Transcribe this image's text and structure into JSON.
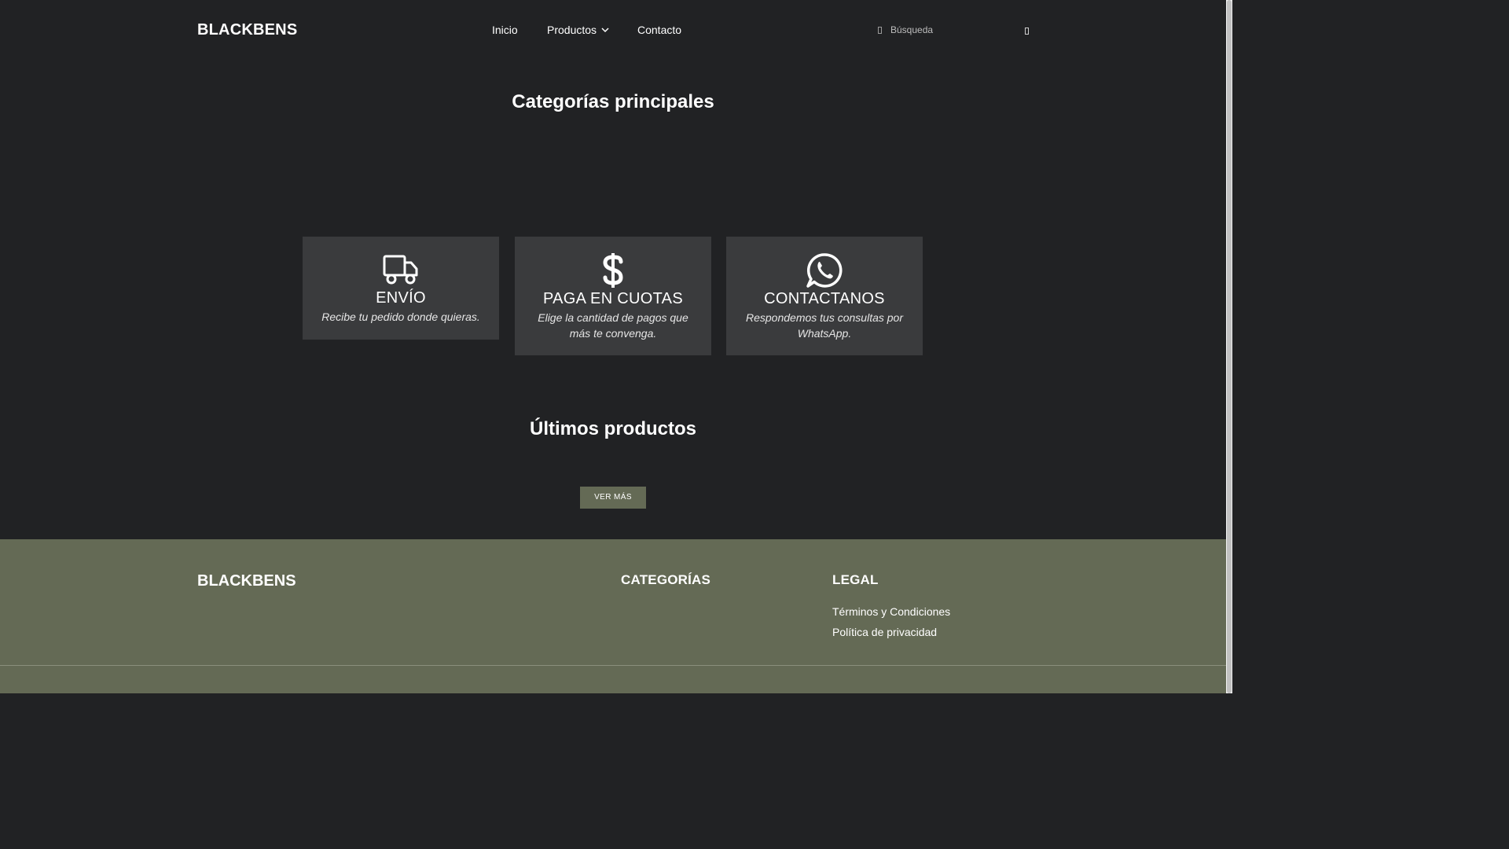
{
  "header": {
    "logo": "BLACKBENS",
    "nav": [
      {
        "label": "Inicio"
      },
      {
        "label": "Productos",
        "icon": "chevron-down-icon"
      },
      {
        "label": "Contacto"
      }
    ],
    "search": {
      "placeholder": "Búsqueda",
      "value": ""
    }
  },
  "categories_section": {
    "title": "Categorías principales"
  },
  "features": [
    {
      "icon": "truck-icon",
      "title": "ENVÍO",
      "description": "Recibe tu pedido donde quieras."
    },
    {
      "icon": "dollar-icon",
      "title": "PAGA EN CUOTAS",
      "description": "Elige la cantidad de pagos que más te convenga."
    },
    {
      "icon": "whatsapp-icon",
      "title": "CONTACTANOS",
      "description": "Respondemos tus consultas por WhatsApp."
    }
  ],
  "latest_section": {
    "title": "Últimos productos",
    "button": "VER MÁS"
  },
  "footer": {
    "logo": "BLACKBENS",
    "categories_heading": "CATEGORÍAS",
    "legal_heading": "LEGAL",
    "legal_links": [
      {
        "label": "Términos y Condiciones"
      },
      {
        "label": "Política de privacidad"
      }
    ]
  },
  "colors": {
    "background": "#212224",
    "card": "#3a3b3d",
    "accent": "#646a55"
  }
}
